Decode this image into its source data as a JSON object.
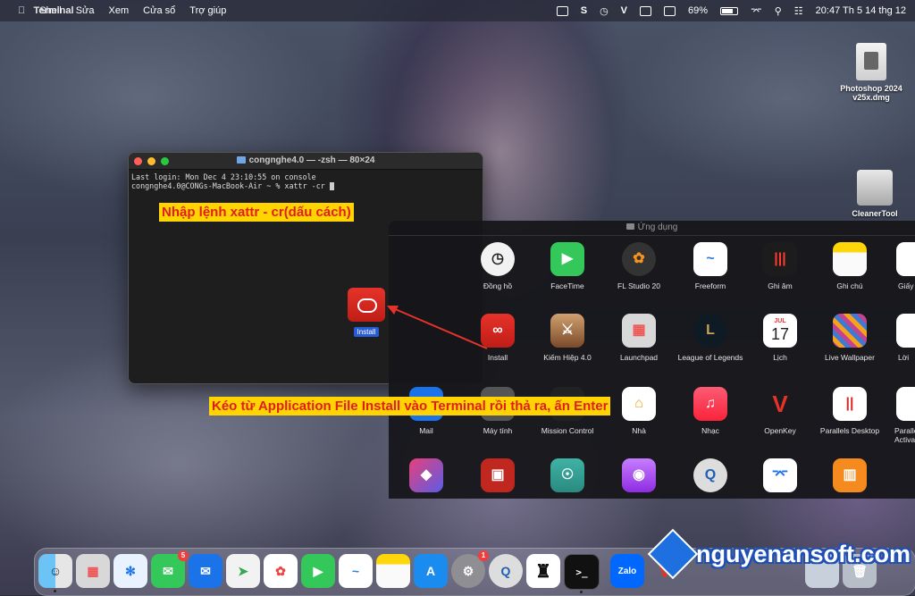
{
  "menubar": {
    "app": "Terminal",
    "menus": [
      "Shell",
      "Sửa",
      "Xem",
      "Cửa sổ",
      "Trợ giúp"
    ],
    "battery": "69%",
    "clock": "20:47 Th 5 14 thg 12"
  },
  "desktop": {
    "icons": [
      {
        "label": "Photoshop 2024 v25x.dmg"
      },
      {
        "label": "CleanerTool"
      }
    ]
  },
  "terminal": {
    "title": "congnghe4.0 — -zsh — 80×24",
    "line1": "Last login: Mon Dec  4 23:10:55 on console",
    "line2": "congnghe4.0@CONGs-MacBook-Air ~ % xattr -cr "
  },
  "annotations": {
    "step1": "Nhập lệnh xattr - cr(dấu cách)",
    "step2": "Kéo từ Application File Install vào Terminal rồi thả ra, ấn Enter"
  },
  "drag_item": {
    "label": "Install"
  },
  "apps_folder": {
    "title": "Ứng dụng",
    "row1": [
      "Đồng hồ",
      "FaceTime",
      "FL Studio 20",
      "Freeform",
      "Ghi âm",
      "Ghi chú",
      "Giấy"
    ],
    "row2": [
      "Install",
      "Kiếm Hiệp 4.0",
      "Launchpad",
      "League of Legends",
      "Lịch",
      "Live Wallpaper",
      "Lời"
    ],
    "row3": [
      "Mail",
      "Máy tính",
      "Mission Control",
      "Nhà",
      "Nhạc",
      "OpenKey",
      "Parallels Desktop",
      "Paralle Activa"
    ],
    "calendar_month": "JUL",
    "calendar_day": "17"
  },
  "dock": {
    "messages_badge": "5",
    "settings_badge": "1",
    "zalo": "Zalo"
  },
  "watermark": "nguyenansoft.com",
  "colors": {
    "annotation_bg": "#ffd400",
    "annotation_text": "#e21d1d",
    "install_label_bg": "#2a5bd7"
  }
}
